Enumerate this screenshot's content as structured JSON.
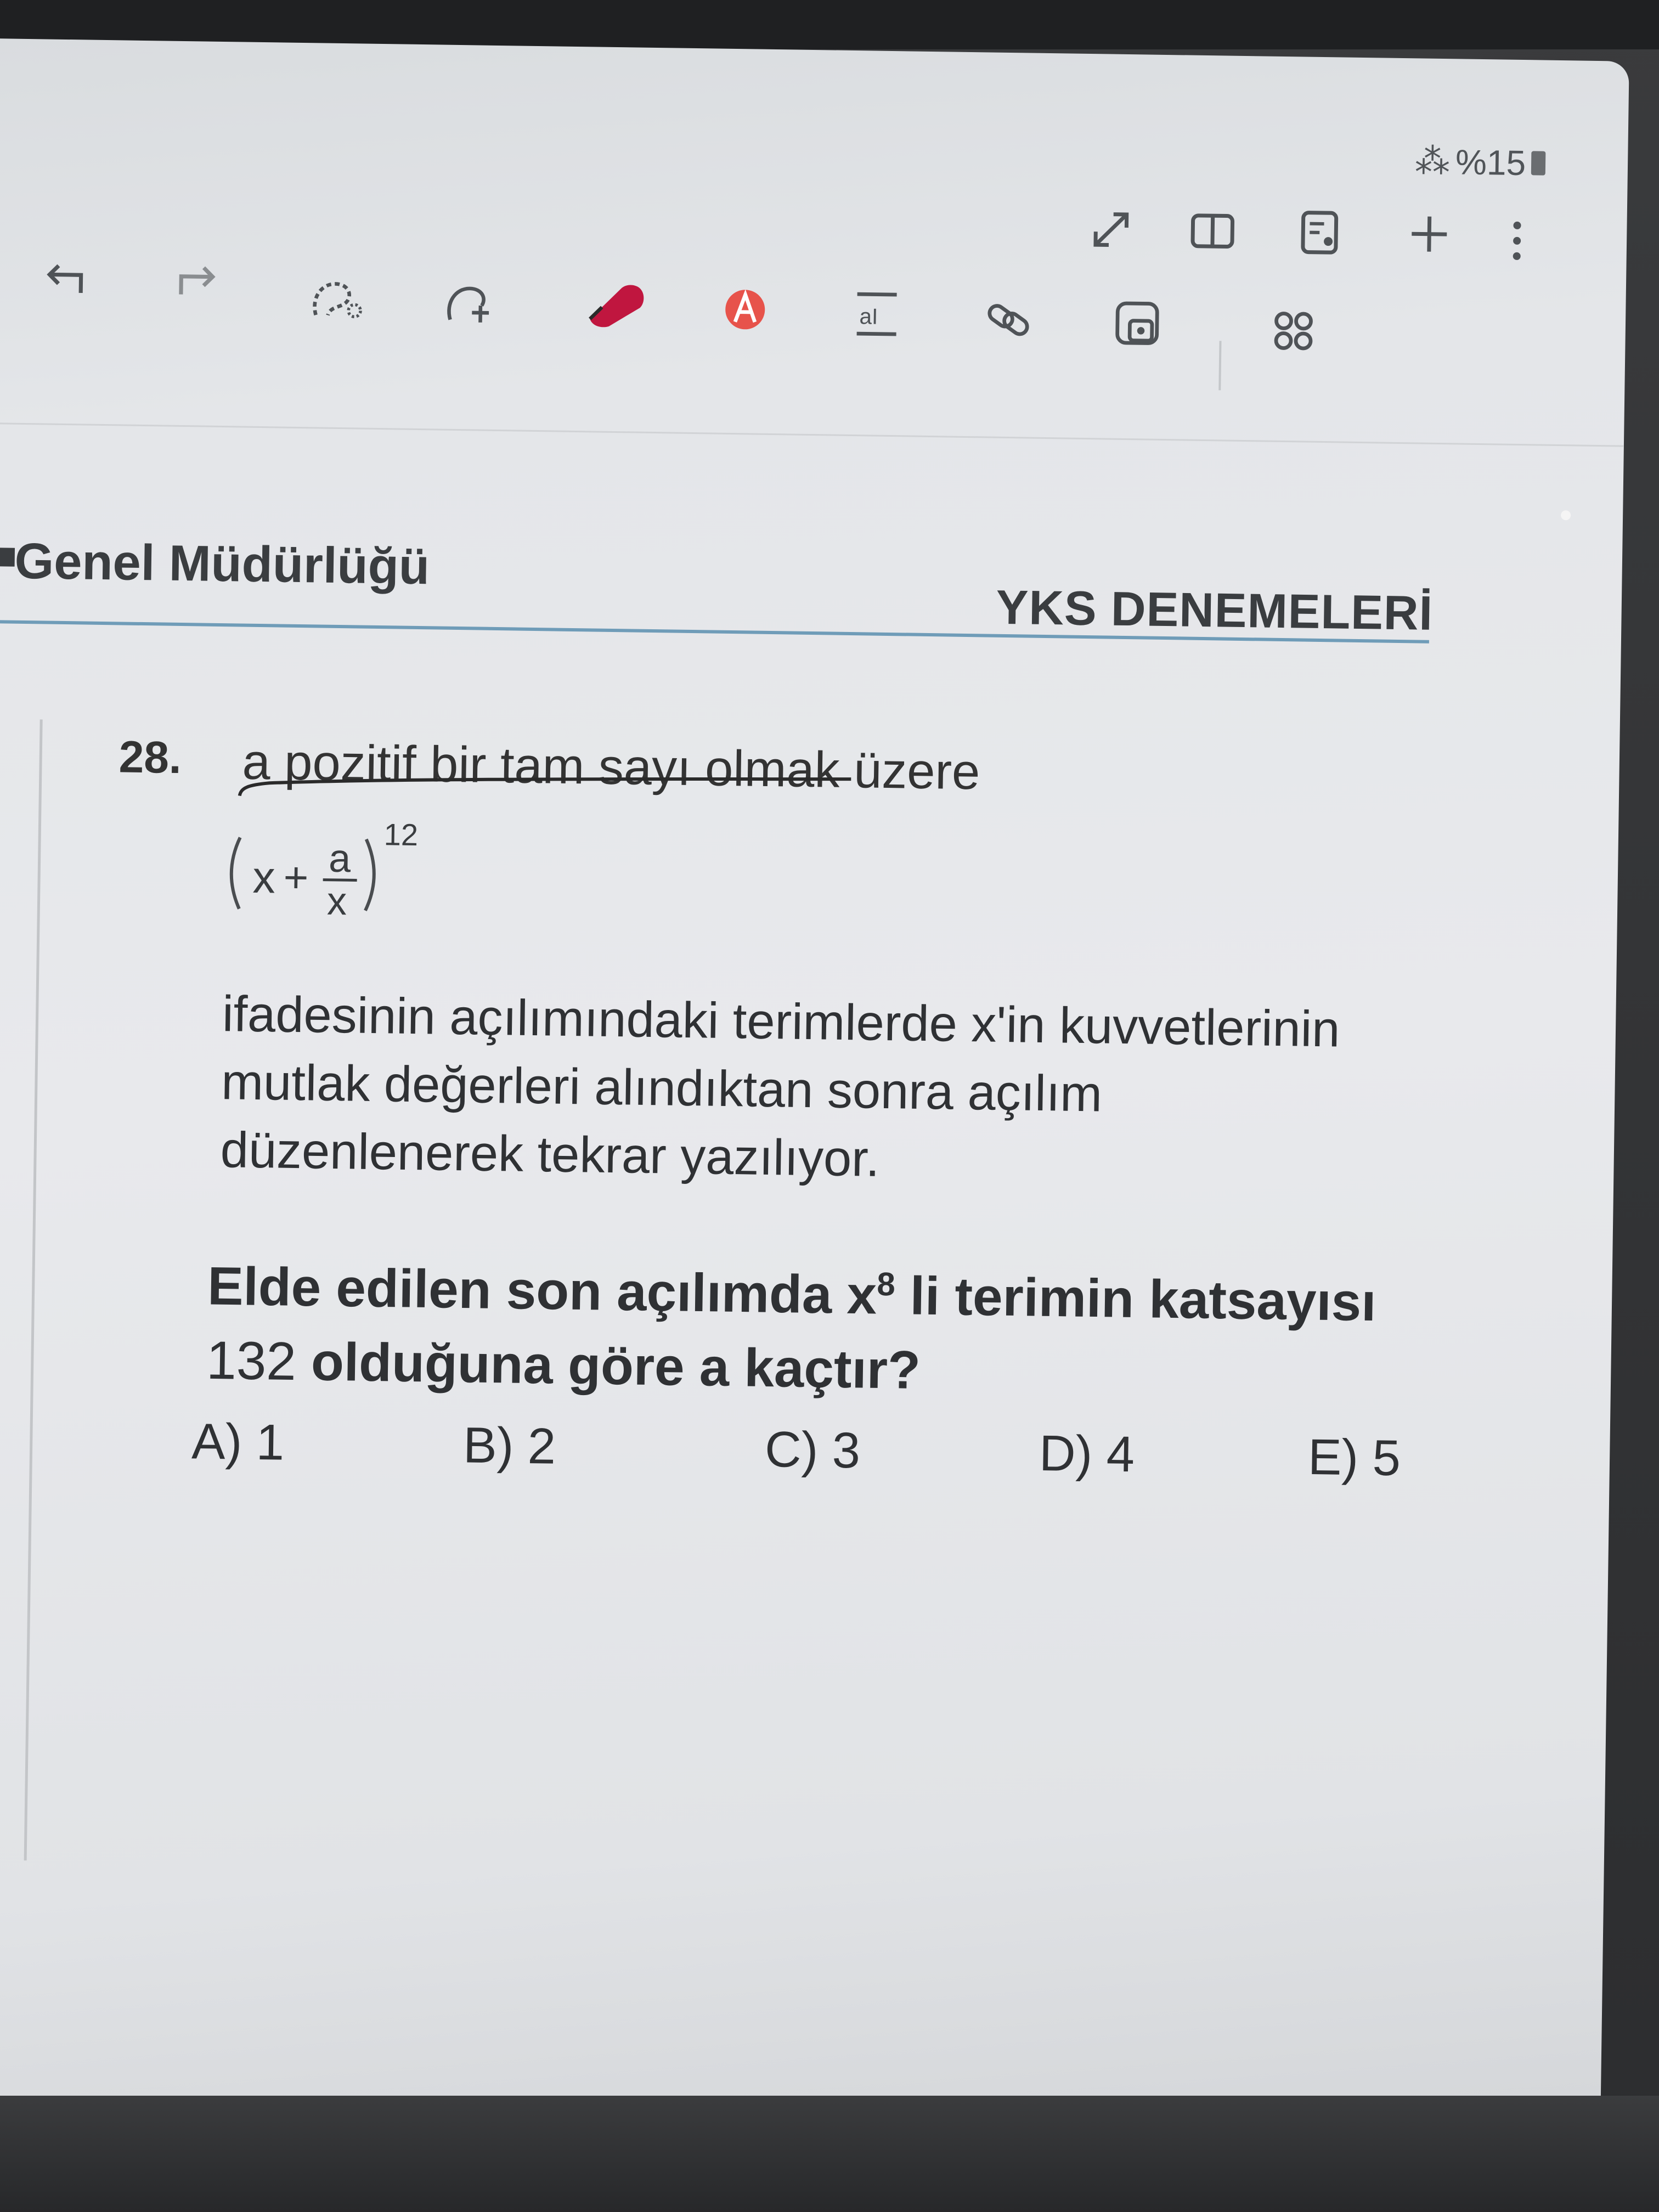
{
  "status_bar": {
    "battery": "%15"
  },
  "toolbar": {
    "icons": {
      "undo": "undo-icon",
      "redo": "redo-icon",
      "lasso": "lasso-select-icon",
      "shape": "shape-pen-icon",
      "eraser": "eraser-icon",
      "text": "text-icon",
      "text_box": "text-box-icon",
      "link": "link-icon",
      "insert_image": "insert-image-icon",
      "grid": "grid-icon",
      "fullscreen": "fullscreen-icon",
      "reading_mode": "reading-mode-icon",
      "page_view": "page-view-icon",
      "add_page": "add-page-icon",
      "more_options": "more-options-icon"
    }
  },
  "document": {
    "header_left": "Genel Müdürlüğü",
    "header_right": "YKS DENEMELERİ",
    "question_number": "28.",
    "intro": "a pozitif bir tam sayı olmak üzere",
    "formula": {
      "variable": "x",
      "operator": "+",
      "numerator": "a",
      "denominator": "x",
      "exponent": "12"
    },
    "body_lines": [
      "ifadesinin açılımındaki terimlerde x'in kuvvetlerinin",
      "mutlak değerleri alındıktan sonra açılım",
      "düzenlenerek tekrar yazılıyor."
    ],
    "question_line1_pre": "Elde edilen son açılımda x",
    "question_line1_sup": "8",
    "question_line1_post": " li terimin katsayısı",
    "question_line2_num": "132",
    "question_line2_rest": " olduğuna göre a kaçtır?",
    "options": [
      "A) 1",
      "B) 2",
      "C) 3",
      "D) 4",
      "E) 5"
    ]
  }
}
